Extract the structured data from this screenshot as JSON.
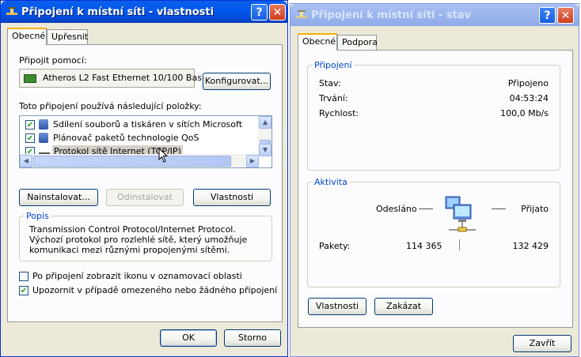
{
  "left_window": {
    "title": "Připojení k místní síti - vlastnosti",
    "help_button": "?",
    "close_button": "✕",
    "tabs": [
      "Obecné",
      "Upřesnit"
    ],
    "connect_using_label": "Připojit pomocí:",
    "adapter_name": "Atheros L2 Fast Ethernet 10/100 Bas",
    "configure_button": "Konfigurovat...",
    "components_label": "Toto připojení používá následující položky:",
    "components": [
      {
        "label": "Sdílení souborů a tiskáren v sítích Microsoft",
        "checked": true,
        "icon": "sharing-icon"
      },
      {
        "label": "Plánovač paketů technologie QoS",
        "checked": true,
        "icon": "qos-icon"
      },
      {
        "label": "Protokol sítě Internet (TCP/IP)",
        "checked": true,
        "icon": "protocol-icon"
      }
    ],
    "install_button": "Nainstalovat...",
    "uninstall_button": "Odinstalovat",
    "properties_button": "Vlastnosti",
    "description_group": "Popis",
    "description_text": "Transmission Control Protocol/Internet Protocol. Výchozí protokol pro rozlehlé sítě, který umožňuje komunikaci mezi různými propojenými sítěmi.",
    "show_icon_label": "Po připojení zobrazit ikonu v oznamovací oblasti",
    "show_icon_checked": false,
    "notify_label": "Upozornit v případě omezeného nebo žádného připojení",
    "notify_checked": true,
    "ok_button": "OK",
    "cancel_button": "Storno"
  },
  "right_window": {
    "title": "Připojení k místní síti - stav",
    "help_button": "?",
    "close_button": "✕",
    "tabs": [
      "Obecné",
      "Podpora"
    ],
    "connection_group": "Připojení",
    "status_label": "Stav:",
    "status_value": "Připojeno",
    "duration_label": "Trvání:",
    "duration_value": "04:53:24",
    "speed_label": "Rychlost:",
    "speed_value": "100,0 Mb/s",
    "activity_group": "Aktivita",
    "sent_label": "Odesláno",
    "received_label": "Přijato",
    "packets_label": "Pakety:",
    "packets_sent": "114 365",
    "packets_received": "132 429",
    "properties_button": "Vlastnosti",
    "disable_button": "Zakázat",
    "close_button_label": "Zavřít"
  },
  "colors": {
    "titlebar_active": "#0058ee",
    "titlebar_inactive": "#9db6ee",
    "group_label": "#0046d5",
    "selection": "#d4d0c8",
    "window_bg": "#ece9d8"
  }
}
